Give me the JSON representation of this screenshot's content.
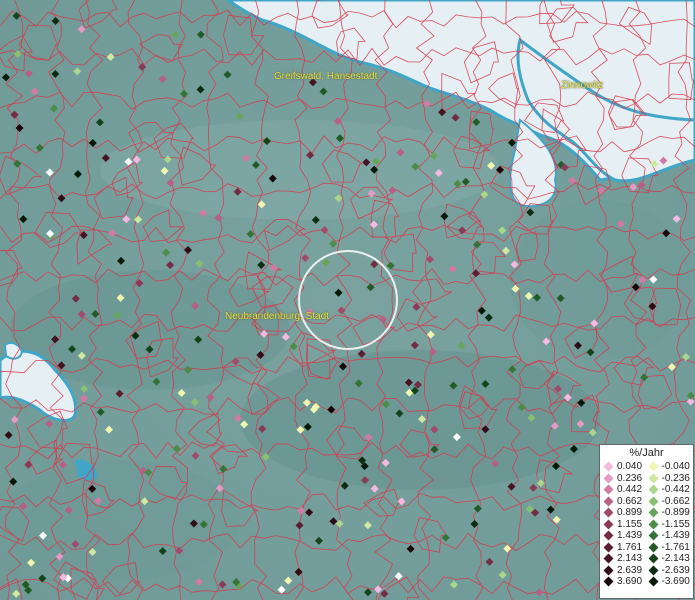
{
  "map": {
    "cities": [
      {
        "name": "Greifswald, Hansestadt"
      },
      {
        "name": "Zinnowitz"
      },
      {
        "name": "Neubrandenburg, Stadt"
      }
    ],
    "colors": {
      "land": "#7fa6a6",
      "water": "#e6f0f4",
      "coast": "#3fa6c8",
      "borders": "#d9384a",
      "highlight_ring": "#ffffff"
    }
  },
  "legend": {
    "title": "%/Jahr",
    "positive": [
      {
        "label": "0.040",
        "color": "#f4b8e2"
      },
      {
        "label": "0.236",
        "color": "#e39ac6"
      },
      {
        "label": "0.442",
        "color": "#d27aa6"
      },
      {
        "label": "0.662",
        "color": "#b85f86"
      },
      {
        "label": "0.899",
        "color": "#a04b6b"
      },
      {
        "label": "1.155",
        "color": "#8a3a56"
      },
      {
        "label": "1.439",
        "color": "#742b43"
      },
      {
        "label": "1.761",
        "color": "#5c1e31"
      },
      {
        "label": "2.143",
        "color": "#461322"
      },
      {
        "label": "2.639",
        "color": "#300b16"
      },
      {
        "label": "3.690",
        "color": "#1a0408"
      }
    ],
    "negative": [
      {
        "label": "-0.040",
        "color": "#f0f7b0"
      },
      {
        "label": "-0.236",
        "color": "#cfe8a0"
      },
      {
        "label": "-0.442",
        "color": "#a9d68a"
      },
      {
        "label": "-0.662",
        "color": "#86c070"
      },
      {
        "label": "-0.899",
        "color": "#67a65a"
      },
      {
        "label": "-1.155",
        "color": "#4b8c46"
      },
      {
        "label": "-1.439",
        "color": "#357336"
      },
      {
        "label": "-1.761",
        "color": "#235b27"
      },
      {
        "label": "-2.143",
        "color": "#16441a"
      },
      {
        "label": "-2.639",
        "color": "#0c2e10"
      },
      {
        "label": "-3.690",
        "color": "#041a06"
      }
    ]
  }
}
